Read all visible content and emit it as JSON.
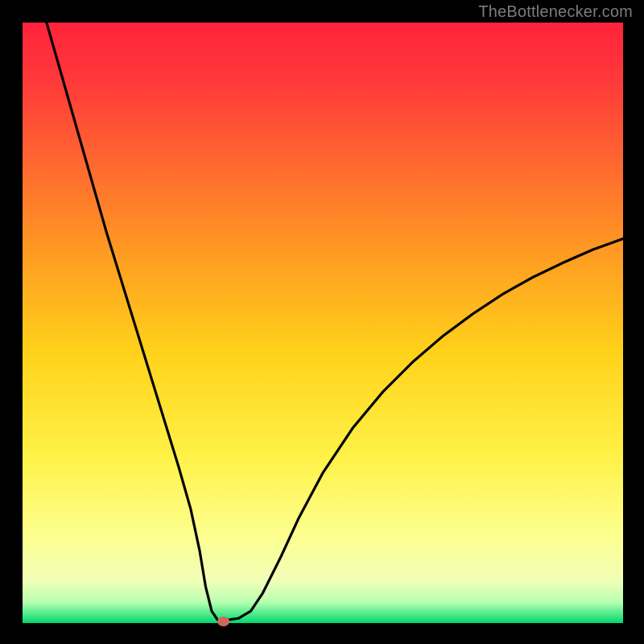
{
  "watermark": "TheBottlenecker.com",
  "colors": {
    "bg": "#000000",
    "grad_top": "#ff2a3d",
    "grad_mid_upper": "#ff8a2a",
    "grad_mid": "#ffd21a",
    "grad_lower": "#fff87a",
    "grad_pale": "#f6ffbf",
    "grad_green": "#00e173",
    "curve": "#000000",
    "dot": "#d1665e",
    "watermark": "#7c7c7c"
  },
  "chart_data": {
    "type": "line",
    "title": "",
    "xlabel": "",
    "ylabel": "",
    "xlim": [
      0,
      100
    ],
    "ylim": [
      0,
      100
    ],
    "grid": false,
    "series": [
      {
        "name": "bottleneck-curve",
        "x": [
          4,
          6,
          8,
          10,
          12,
          14,
          16,
          18,
          20,
          22,
          24,
          26,
          28,
          29.5,
          30.5,
          31.5,
          32.5,
          34,
          36,
          38,
          40,
          43,
          46,
          50,
          55,
          60,
          65,
          70,
          75,
          80,
          85,
          90,
          95,
          100
        ],
        "y": [
          100,
          93,
          86,
          79,
          72,
          65,
          58.5,
          52,
          45.5,
          39,
          32.5,
          26,
          19,
          12,
          6,
          2,
          0.5,
          0.5,
          0.8,
          2,
          5,
          11,
          17.5,
          25,
          32.5,
          38.5,
          43.5,
          47.8,
          51.5,
          54.8,
          57.6,
          60,
          62.2,
          64
        ]
      }
    ],
    "marker": {
      "x": 33.5,
      "y": 0.3
    }
  }
}
